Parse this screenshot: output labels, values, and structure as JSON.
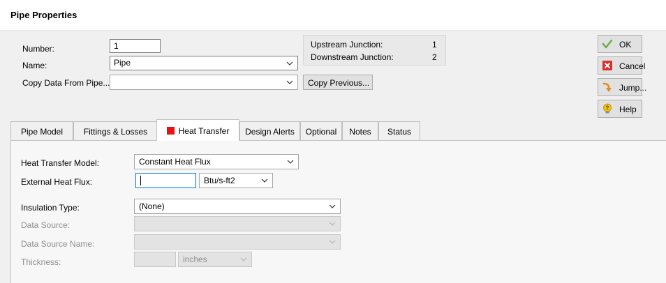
{
  "window": {
    "title": "Pipe Properties"
  },
  "fields": {
    "number_label": "Number:",
    "number_value": "1",
    "name_label": "Name:",
    "name_value": "Pipe",
    "copy_from_label": "Copy Data From Pipe...",
    "copy_from_value": ""
  },
  "junctions": {
    "upstream_label": "Upstream Junction:",
    "upstream_value": "1",
    "downstream_label": "Downstream Junction:",
    "downstream_value": "2"
  },
  "copy_previous_label": "Copy Previous...",
  "side_buttons": {
    "ok": "OK",
    "cancel": "Cancel",
    "jump": "Jump...",
    "help": "Help"
  },
  "tabs": [
    {
      "label": "Pipe Model",
      "active": false
    },
    {
      "label": "Fittings & Losses",
      "active": false
    },
    {
      "label": "Heat Transfer",
      "active": true
    },
    {
      "label": "Design Alerts",
      "active": false
    },
    {
      "label": "Optional",
      "active": false
    },
    {
      "label": "Notes",
      "active": false
    },
    {
      "label": "Status",
      "active": false
    }
  ],
  "heat_transfer": {
    "model_label": "Heat Transfer Model:",
    "model_value": "Constant Heat Flux",
    "flux_label": "External Heat Flux:",
    "flux_value": "",
    "flux_unit": "Btu/s-ft2",
    "insulation_label": "Insulation Type:",
    "insulation_value": "(None)",
    "data_source_label": "Data Source:",
    "data_source_value": "",
    "data_source_name_label": "Data Source Name:",
    "data_source_name_value": "",
    "thickness_label": "Thickness:",
    "thickness_value": "",
    "thickness_unit": "inches"
  },
  "colors": {
    "heat_transfer_tab_marker": "#e8120f",
    "ok_check": "#6ab04c",
    "cancel_x": "#d9302b",
    "jump_arrow": "#e08a2a",
    "help_bulb": "#f0c400"
  },
  "icons": [
    "check-icon",
    "close-icon",
    "jump-arrow-icon",
    "help-bulb-icon",
    "chevron-down-icon"
  ]
}
